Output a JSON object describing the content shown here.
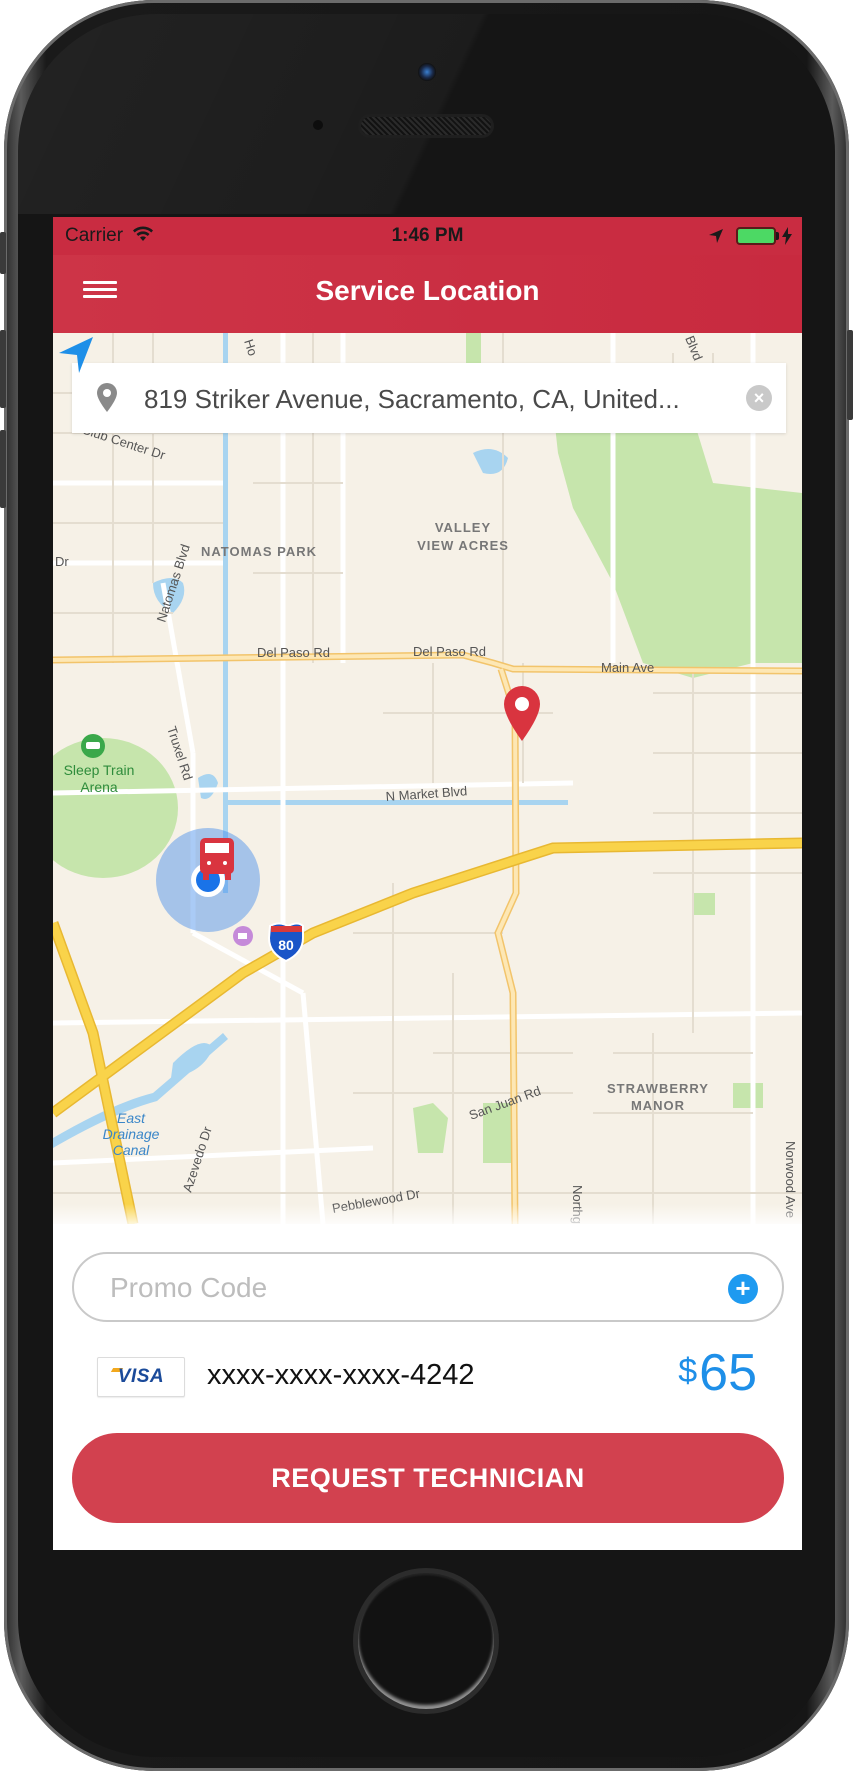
{
  "status_bar": {
    "carrier": "Carrier",
    "time": "1:46 PM",
    "battery_color": "#4cd964"
  },
  "nav": {
    "title": "Service Location",
    "menu_icon": "hamburger-menu-icon"
  },
  "search": {
    "value": "819 Striker Avenue, Sacramento, CA, United...",
    "pin_icon": "location-pin-icon",
    "clear_icon": "clear-x-icon",
    "clear_label": "×"
  },
  "map": {
    "labels": {
      "club_center": "Club Center Dr",
      "natomas_park": "NATOMAS PARK",
      "valley": "VALLEY",
      "view_acres": "VIEW ACRES",
      "natomas_blvd": "Natomas Blvd",
      "del_paso_1": "Del Paso Rd",
      "del_paso_2": "Del Paso Rd",
      "main_ave": "Main Ave",
      "truxel": "Truxel Rd",
      "sleep_train_1": "Sleep Train",
      "sleep_train_2": "Arena",
      "n_market": "N Market Blvd",
      "i80": "80",
      "east": "East",
      "drainage": "Drainage",
      "canal": "Canal",
      "azevedo": "Azevedo Dr",
      "san_juan": "San Juan Rd",
      "pebblewood": "Pebblewood Dr",
      "strawberry": "STRAWBERRY",
      "manor": "MANOR",
      "norwood": "Norwood Ave",
      "northgate": "Northga",
      "dr": "Dr",
      "hor": "Ho",
      "blvd_top": "Blvd"
    },
    "colors": {
      "land": "#f6f1e7",
      "park": "#c6e5ac",
      "water": "#a8d4f0",
      "highway": "#f9d34a",
      "arterial": "#fbe3a8",
      "street": "#ffffff",
      "destination_pin": "#d9343f",
      "user_location": "#1a73e8"
    }
  },
  "promo": {
    "placeholder": "Promo Code",
    "value": "",
    "add_label": "+"
  },
  "payment": {
    "card_brand": "VISA",
    "card_number": "xxxx-xxxx-xxxx-4242",
    "currency_symbol": "$",
    "amount": "65"
  },
  "actions": {
    "request_label": "REQUEST TECHNICIAN"
  }
}
